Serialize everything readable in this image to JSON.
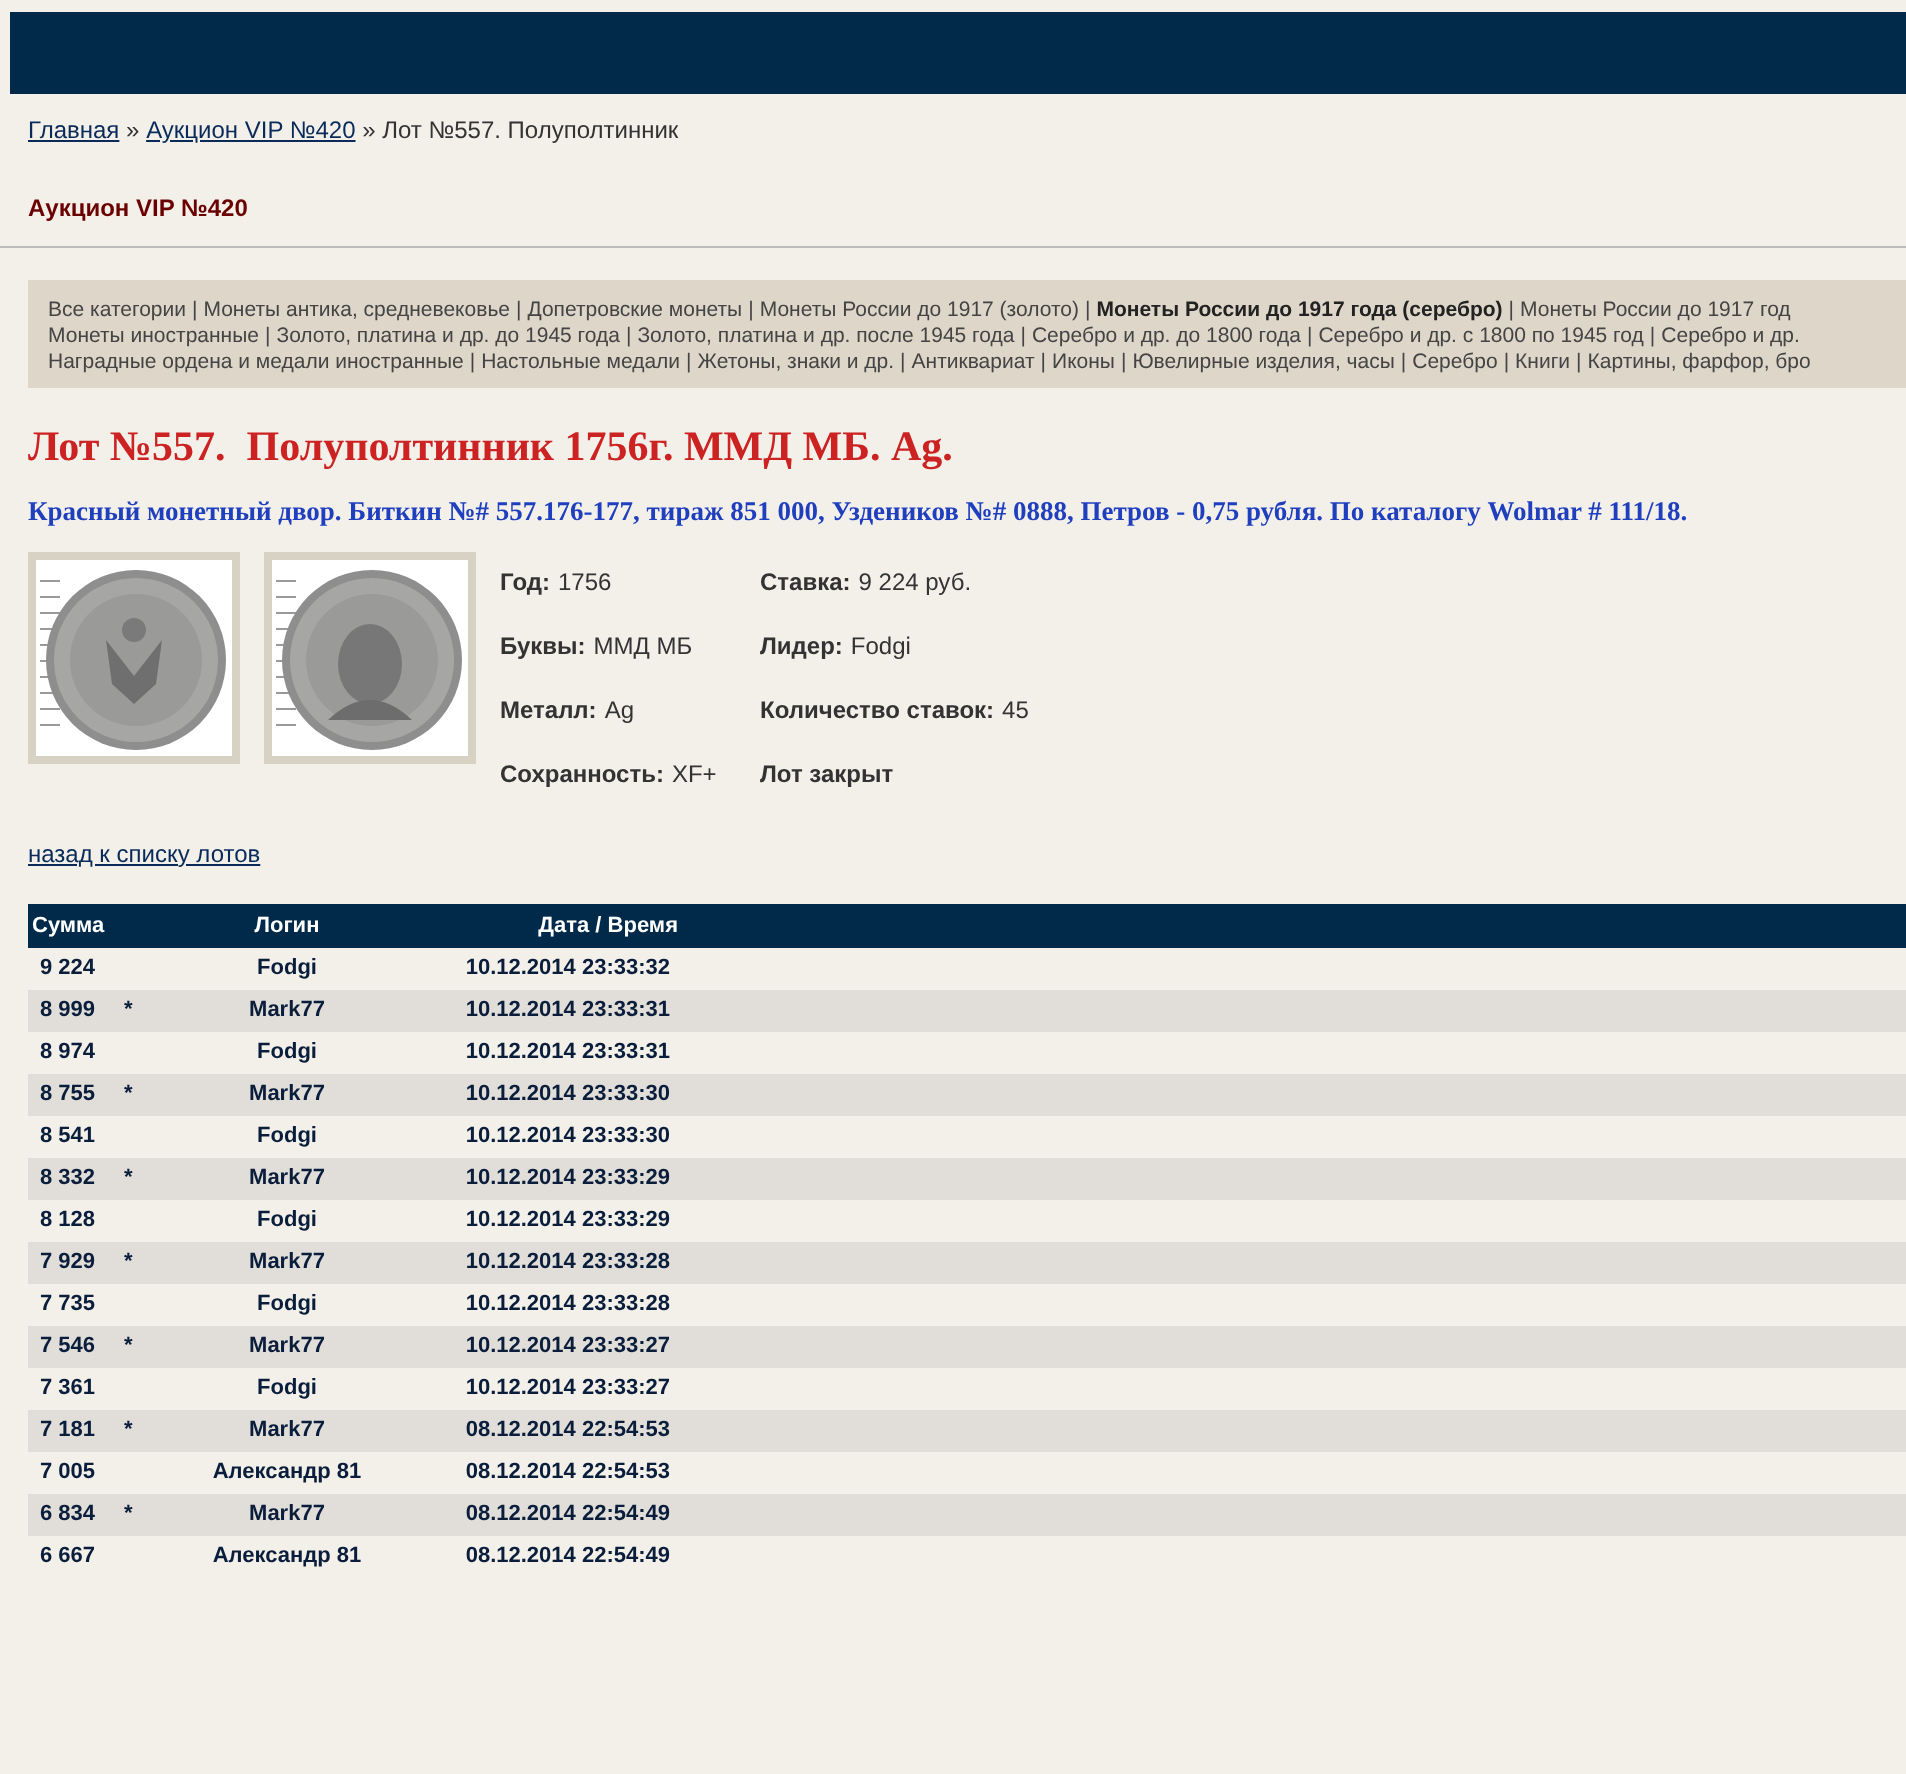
{
  "breadcrumb": [
    {
      "label": "Главная",
      "kind": "link"
    },
    {
      "label": "»",
      "kind": "separator"
    },
    {
      "label": "Аукцион VIP №420",
      "kind": "link"
    },
    {
      "label": "»",
      "kind": "separator"
    },
    {
      "label": "Лот №557. Полуполтинник",
      "kind": "current"
    }
  ],
  "section_title": "Аукцион VIP №420",
  "categories": [
    [
      {
        "label": "Все категории",
        "selected": false,
        "separator": "|"
      },
      {
        "label": "Монеты антика, средневековье",
        "selected": false,
        "separator": "|"
      },
      {
        "label": "Допетровские монеты",
        "selected": false,
        "separator": "|"
      },
      {
        "label": "Монеты России до 1917 (золото)",
        "selected": false,
        "separator": "|"
      },
      {
        "label": "Монеты России до 1917 года (серебро)",
        "selected": true,
        "separator": "|"
      },
      {
        "label": "Монеты России до 1917 год",
        "selected": false
      }
    ],
    [
      {
        "label": "Монеты иностранные",
        "selected": false,
        "separator": "|"
      },
      {
        "label": "Золото, платина и др. до 1945 года",
        "selected": false,
        "separator": "|"
      },
      {
        "label": "Золото, платина и др. после 1945 года",
        "selected": false,
        "separator": "|"
      },
      {
        "label": "Серебро и др. до 1800 года",
        "selected": false,
        "separator": "|"
      },
      {
        "label": "Серебро и др. с 1800 по 1945 год",
        "selected": false,
        "separator": "|"
      },
      {
        "label": "Серебро и др.",
        "selected": false
      }
    ],
    [
      {
        "label": "Наградные ордена и медали иностранные",
        "selected": false,
        "separator": "|"
      },
      {
        "label": "Настольные медали",
        "selected": false,
        "separator": "|"
      },
      {
        "label": "Жетоны, знаки и др.",
        "selected": false,
        "separator": "|"
      },
      {
        "label": "Антиквариат",
        "selected": false,
        "separator": "|"
      },
      {
        "label": "Иконы",
        "selected": false,
        "separator": "|"
      },
      {
        "label": "Ювелирные изделия, часы",
        "selected": false,
        "separator": "|"
      },
      {
        "label": "Серебро",
        "selected": false,
        "separator": "|"
      },
      {
        "label": "Книги",
        "selected": false,
        "separator": "|"
      },
      {
        "label": "Картины, фарфор, бро",
        "selected": false
      }
    ]
  ],
  "lot": {
    "title": "Лот №557.  Полуполтинник 1756г. ММД МБ. Ag.",
    "description": "Красный монетный двор. Биткин №# 557.176-177, тираж 851 000, Уздеников №# 0888, Петров - 0,75 рубля. По каталогу Wolmar # 111/18.",
    "images": [
      {
        "kind": "picture"
      },
      {
        "kind": "picture"
      }
    ],
    "details": [
      [
        {
          "label": "Год:",
          "value": "1756"
        },
        {
          "label": "Буквы:",
          "value": "ММД МБ"
        },
        {
          "label": "Металл:",
          "value": "Ag"
        },
        {
          "label": "Сохранность:",
          "value": "XF+"
        }
      ],
      [
        {
          "label": "Ставка:",
          "value": "9 224 руб."
        },
        {
          "label": "Лидер:",
          "value": "Fodgi"
        },
        {
          "label": "Количество ставок:",
          "value": "45"
        },
        {
          "label": "Лот закрыт"
        }
      ]
    ]
  },
  "back_link": "назад к списку лотов",
  "bids": {
    "columns": [
      "Сумма",
      "Логин",
      "Дата / Время"
    ],
    "rows": [
      {
        "amount": "9 224",
        "login": "Fodgi",
        "time": "10.12.2014 23:33:32"
      },
      {
        "amount": "8 999",
        "note": "*",
        "login": "Mark77",
        "time": "10.12.2014 23:33:31"
      },
      {
        "amount": "8 974",
        "login": "Fodgi",
        "time": "10.12.2014 23:33:31"
      },
      {
        "amount": "8 755",
        "note": "*",
        "login": "Mark77",
        "time": "10.12.2014 23:33:30"
      },
      {
        "amount": "8 541",
        "login": "Fodgi",
        "time": "10.12.2014 23:33:30"
      },
      {
        "amount": "8 332",
        "note": "*",
        "login": "Mark77",
        "time": "10.12.2014 23:33:29"
      },
      {
        "amount": "8 128",
        "login": "Fodgi",
        "time": "10.12.2014 23:33:29"
      },
      {
        "amount": "7 929",
        "note": "*",
        "login": "Mark77",
        "time": "10.12.2014 23:33:28"
      },
      {
        "amount": "7 735",
        "login": "Fodgi",
        "time": "10.12.2014 23:33:28"
      },
      {
        "amount": "7 546",
        "note": "*",
        "login": "Mark77",
        "time": "10.12.2014 23:33:27"
      },
      {
        "amount": "7 361",
        "login": "Fodgi",
        "time": "10.12.2014 23:33:27"
      },
      {
        "amount": "7 181",
        "note": "*",
        "login": "Mark77",
        "time": "08.12.2014 22:54:53"
      },
      {
        "amount": "7 005",
        "login": "Александр 81",
        "time": "08.12.2014 22:54:53"
      },
      {
        "amount": "6 834",
        "note": "*",
        "login": "Mark77",
        "time": "08.12.2014 22:54:49"
      },
      {
        "amount": "6 667",
        "login": "Александр 81",
        "time": "08.12.2014 22:54:49"
      }
    ]
  }
}
